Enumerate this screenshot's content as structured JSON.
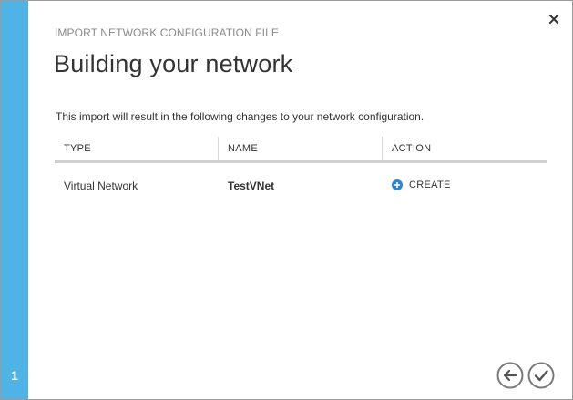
{
  "dialog": {
    "subtitle": "IMPORT NETWORK CONFIGURATION FILE",
    "title": "Building your network",
    "description": "This import will result in the following changes to your network configuration.",
    "step": "1"
  },
  "table": {
    "headers": {
      "type": "TYPE",
      "name": "NAME",
      "action": "ACTION"
    },
    "rows": [
      {
        "type": "Virtual Network",
        "name": "TestVNet",
        "action": "CREATE"
      }
    ]
  },
  "icons": {
    "close": "close-icon",
    "back": "arrow-left-icon",
    "finish": "checkmark-icon",
    "create": "plus-circle-icon"
  },
  "colors": {
    "accent": "#4fb3e6",
    "plus": "#2e86d1"
  }
}
